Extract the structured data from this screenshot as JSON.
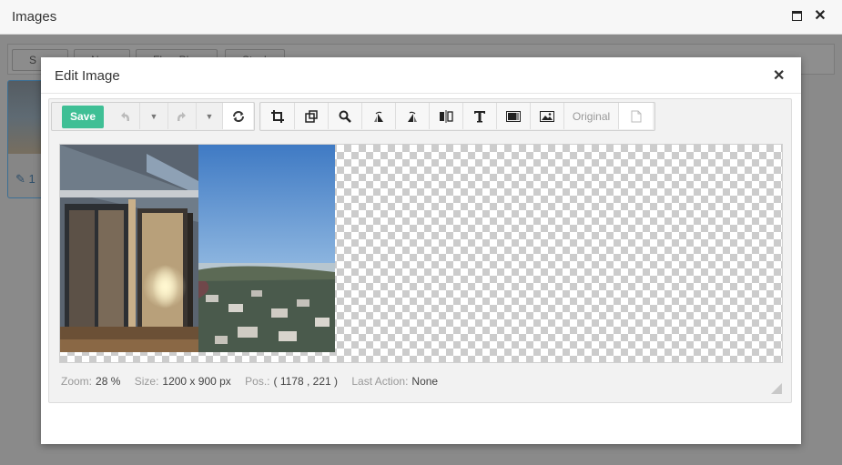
{
  "window": {
    "title": "Images"
  },
  "background": {
    "toolbar": {
      "buttons": [
        "S",
        "N",
        "Flow Pl",
        "Stack"
      ]
    },
    "thumbnail": {
      "edit_label": "1"
    }
  },
  "modal": {
    "title": "Edit Image",
    "save_label": "Save",
    "original_label": "Original"
  },
  "toolbar_icons": [
    "undo-icon",
    "dropdown-caret-icon",
    "redo-icon",
    "dropdown-caret-icon",
    "reset-icon",
    "crop-icon",
    "resize-icon",
    "zoom-icon",
    "rotate-left-icon",
    "rotate-right-icon",
    "flip-icon",
    "text-icon",
    "filter-icon",
    "image-overlay-icon",
    "original-file-icon"
  ],
  "status": {
    "zoom_label": "Zoom:",
    "zoom_value": "28 %",
    "size_label": "Size:",
    "size_value": "1200 x 900 px",
    "pos_label": "Pos.:",
    "pos_value": "( 1178 , 221 )",
    "last_action_label": "Last Action:",
    "last_action_value": "None"
  },
  "colors": {
    "save": "#3fbf95",
    "checker": "#cccccc"
  }
}
